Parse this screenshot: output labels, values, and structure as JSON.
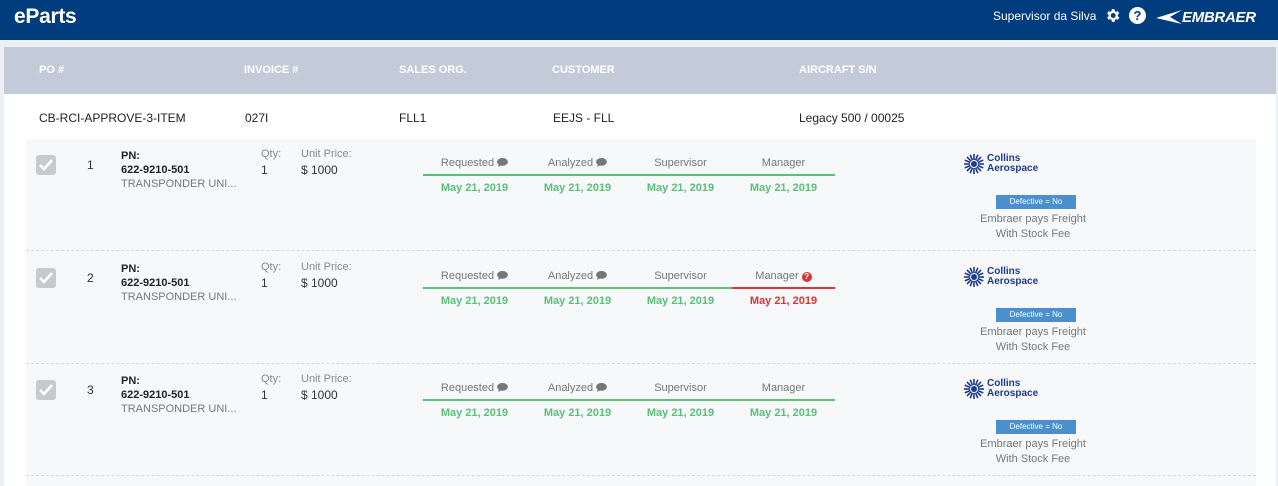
{
  "app": {
    "title": "eParts"
  },
  "user": {
    "name": "Supervisor da Silva"
  },
  "brand": {
    "logo_text": "EMBRAER"
  },
  "icons": {
    "settings": "gear-icon",
    "help": "help-icon",
    "comment": "comment-icon",
    "check": "check-icon",
    "alert": "question-circle-icon"
  },
  "colors": {
    "topbar": "#003c7e",
    "header": "#c3cbd8",
    "step_ok": "#5bbf78",
    "step_alert": "#d33333",
    "defect_badge": "#4b8fcf"
  },
  "columns": {
    "po": "PO #",
    "invoice": "INVOICE #",
    "sales_org": "SALES ORG.",
    "customer": "CUSTOMER",
    "aircraft": "AIRCRAFT S/N"
  },
  "order": {
    "po": "CB-RCI-APPROVE-3-ITEM",
    "invoice": "027I",
    "sales_org": "FLL1",
    "customer": "EEJS - FLL",
    "aircraft": "Legacy 500 / 00025"
  },
  "labels": {
    "pn": "PN:",
    "qty": "Qty:",
    "unit_price": "Unit Price:"
  },
  "items": [
    {
      "index": "1",
      "pn": "622-9210-501",
      "description": "TRANSPONDER UNI...",
      "qty": "1",
      "price": "$ 1000",
      "steps": [
        {
          "name": "Requested",
          "date": "May 21, 2019",
          "status": "ok"
        },
        {
          "name": "Analyzed",
          "date": "May 21, 2019",
          "status": "ok"
        },
        {
          "name": "Supervisor",
          "date": "May 21, 2019",
          "status": "ok"
        },
        {
          "name": "Manager",
          "date": "May 21, 2019",
          "status": "ok"
        }
      ],
      "vendor": {
        "line1": "Collins",
        "line2": "Aerospace"
      },
      "defective": "Defective = No",
      "freight_line1": "Embraer pays Freight",
      "freight_line2": "With Stock Fee"
    },
    {
      "index": "2",
      "pn": "622-9210-501",
      "description": "TRANSPONDER UNI...",
      "qty": "1",
      "price": "$ 1000",
      "steps": [
        {
          "name": "Requested",
          "date": "May 21, 2019",
          "status": "ok"
        },
        {
          "name": "Analyzed",
          "date": "May 21, 2019",
          "status": "ok"
        },
        {
          "name": "Supervisor",
          "date": "May 21, 2019",
          "status": "ok"
        },
        {
          "name": "Manager",
          "date": "May 21, 2019",
          "status": "alert"
        }
      ],
      "vendor": {
        "line1": "Collins",
        "line2": "Aerospace"
      },
      "defective": "Defective = No",
      "freight_line1": "Embraer pays Freight",
      "freight_line2": "With Stock Fee"
    },
    {
      "index": "3",
      "pn": "622-9210-501",
      "description": "TRANSPONDER UNI...",
      "qty": "1",
      "price": "$ 1000",
      "steps": [
        {
          "name": "Requested",
          "date": "May 21, 2019",
          "status": "ok"
        },
        {
          "name": "Analyzed",
          "date": "May 21, 2019",
          "status": "ok"
        },
        {
          "name": "Supervisor",
          "date": "May 21, 2019",
          "status": "ok"
        },
        {
          "name": "Manager",
          "date": "May 21, 2019",
          "status": "ok"
        }
      ],
      "vendor": {
        "line1": "Collins",
        "line2": "Aerospace"
      },
      "defective": "Defective = No",
      "freight_line1": "Embraer pays Freight",
      "freight_line2": "With Stock Fee"
    }
  ]
}
